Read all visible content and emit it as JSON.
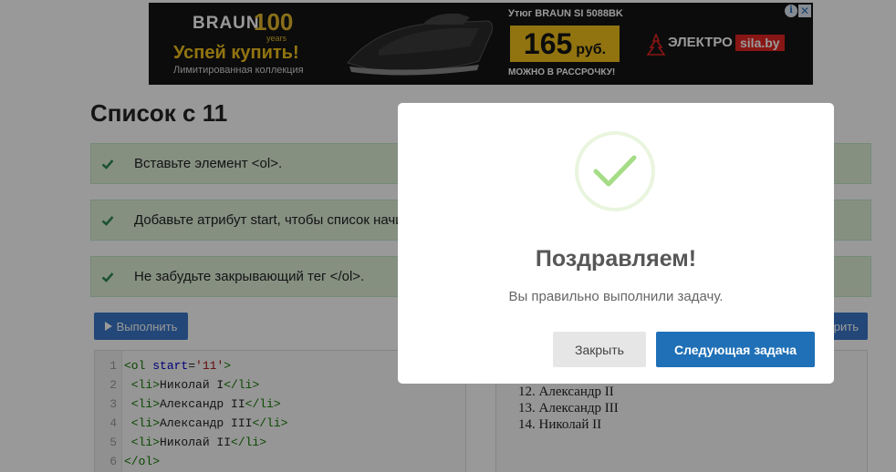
{
  "ad": {
    "brand": "BRAUN",
    "brand_hundred": "100",
    "brand_years": "years",
    "slogan": "Успей купить!",
    "collection": "Лимитированная коллекция",
    "product": "Утюг BRAUN SI 5088BK",
    "price_number": "165",
    "price_currency": "руб.",
    "installment": "МОЖНО В РАССРОЧКУ!",
    "store_name": "ЭЛЕКТРО",
    "store_domain": "sila.by",
    "choices_icon": "adchoices-icon",
    "close_icon": "close-icon"
  },
  "page": {
    "title": "Список с 11",
    "tasks": [
      {
        "text": "Вставьте элемент <ol>."
      },
      {
        "text": "Добавьте атрибут start, чтобы список начи"
      },
      {
        "text": "Не забудьте закрывающий тег </ol>."
      }
    ],
    "run_button": "Выполнить",
    "right_button_fragment": "рить"
  },
  "editor": {
    "lines": [
      {
        "num": "1",
        "t1": "<ol ",
        "a1": "start",
        "eq": "=",
        "s1": "'11'",
        "t2": ">",
        "txt": "",
        "t3": ""
      },
      {
        "num": "2",
        "t1": " <li>",
        "a1": "",
        "eq": "",
        "s1": "",
        "t2": "",
        "txt": "Николай I",
        "t3": "</li>"
      },
      {
        "num": "3",
        "t1": " <li>",
        "a1": "",
        "eq": "",
        "s1": "",
        "t2": "",
        "txt": "Александр II",
        "t3": "</li>"
      },
      {
        "num": "4",
        "t1": " <li>",
        "a1": "",
        "eq": "",
        "s1": "",
        "t2": "",
        "txt": "Александр III",
        "t3": "</li>"
      },
      {
        "num": "5",
        "t1": " <li>",
        "a1": "",
        "eq": "",
        "s1": "",
        "t2": "",
        "txt": "Николай II",
        "t3": "</li>"
      },
      {
        "num": "6",
        "t1": "</ol>",
        "a1": "",
        "eq": "",
        "s1": "",
        "t2": "",
        "txt": "",
        "t3": ""
      }
    ]
  },
  "result": {
    "items": [
      "12. Александр II",
      "13. Александр III",
      "14. Николай II"
    ]
  },
  "modal": {
    "title": "Поздравляем!",
    "text": "Вы правильно выполнили задачу.",
    "close_button": "Закрыть",
    "next_button": "Следующая задача",
    "icon": "checkmark-icon",
    "success_color": "#a5dc86",
    "primary_color": "#1f70b7"
  }
}
